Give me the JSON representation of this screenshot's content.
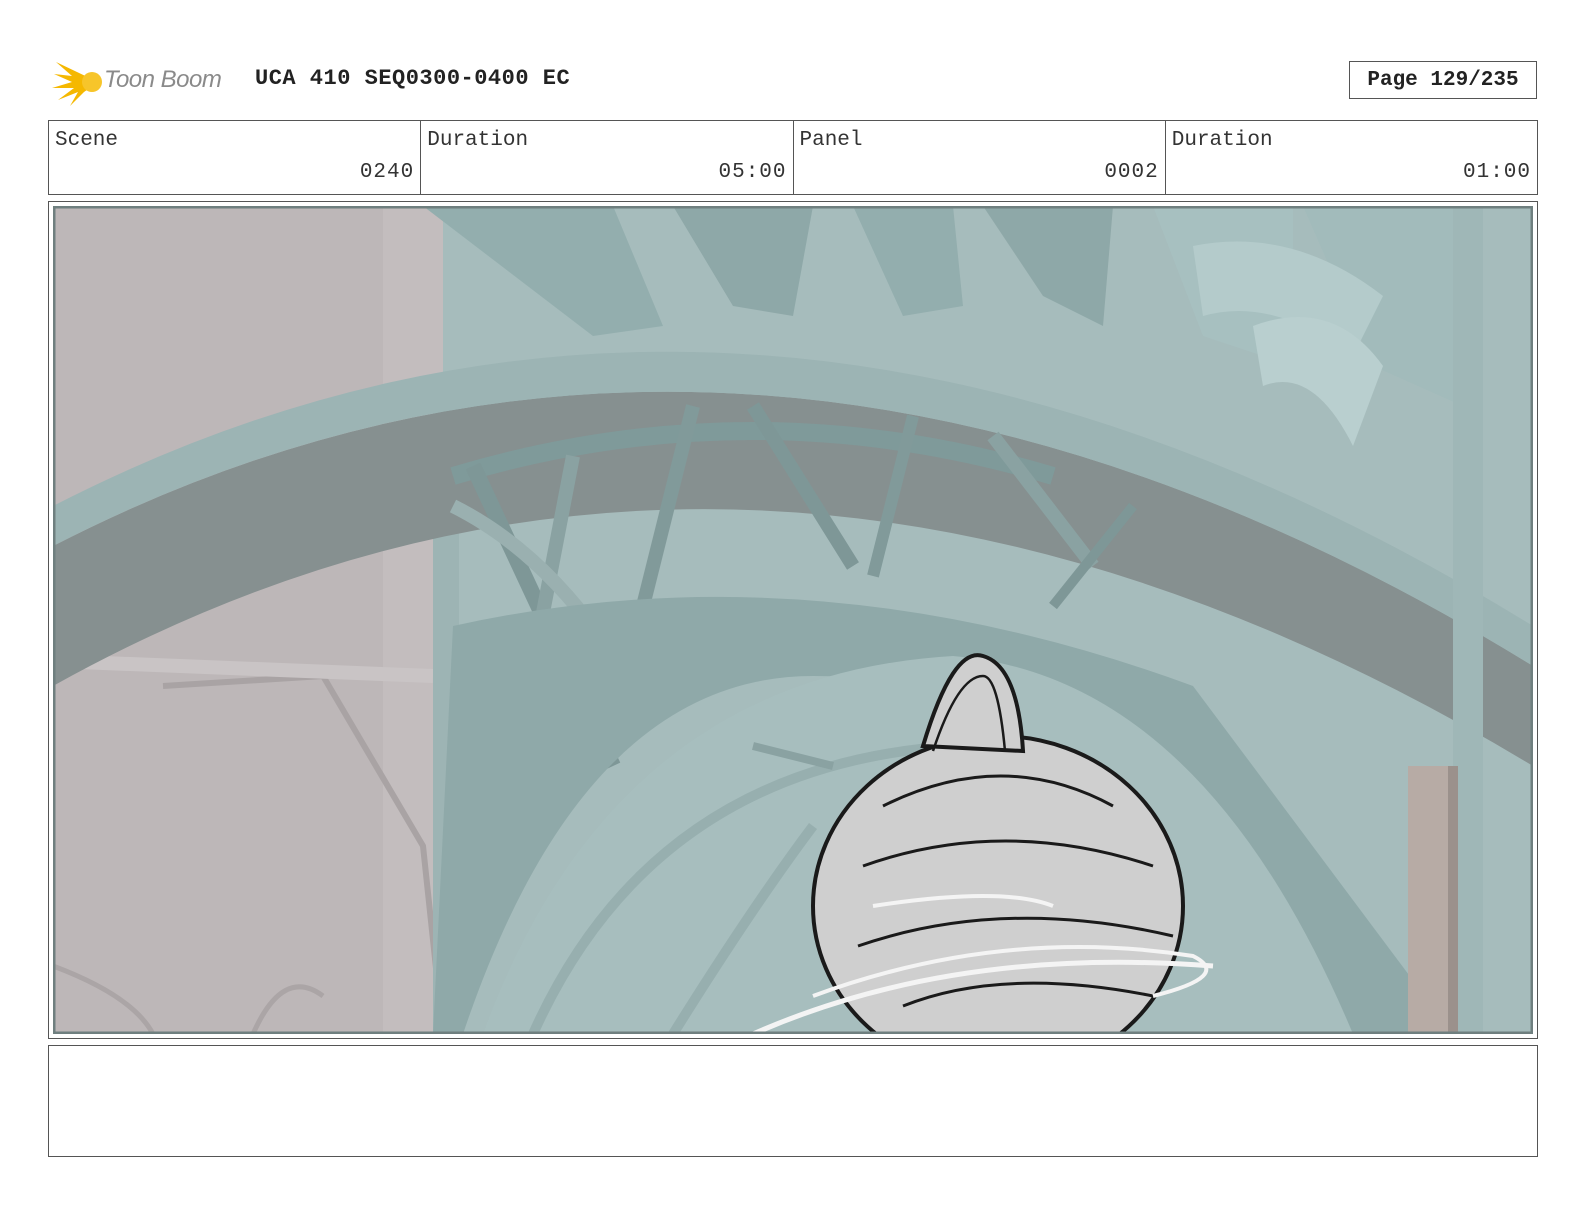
{
  "header": {
    "logo_text": "Toon Boom",
    "doc_title": "UCA 410 SEQ0300-0400 EC",
    "page_label": "Page 129/235"
  },
  "info": {
    "scene_label": "Scene",
    "scene_value": "0240",
    "scene_duration_label": "Duration",
    "scene_duration_value": "05:00",
    "panel_label": "Panel",
    "panel_value": "0002",
    "panel_duration_label": "Duration",
    "panel_duration_value": "01:00"
  },
  "colors": {
    "logo_accent": "#f5b800",
    "wall": "#bdb7b8",
    "metal": "#93aeae",
    "metal_dark": "#7f9696",
    "arch_band": "#869090",
    "bg_teal": "#a6bcbc",
    "bell": "#cfcfcf"
  },
  "notes": {
    "text": ""
  }
}
